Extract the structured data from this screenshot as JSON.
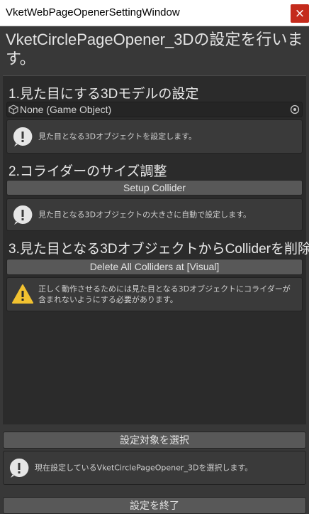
{
  "window": {
    "title": "VketWebPageOpenerSettingWindow",
    "close_glyph": "×"
  },
  "heading": "VketCirclePageOpener_3Dの設定を行います。",
  "section1": {
    "title": "1.見た目にする3Dモデルの設定",
    "object_field_value": "None (Game Object)",
    "help": "見た目となる3Dオブジェクトを設定します。"
  },
  "section2": {
    "title": "2.コライダーのサイズ調整",
    "button": "Setup Collider",
    "help": "見た目となる3Dオブジェクトの大きさに自動で設定します。"
  },
  "section3": {
    "title": "3.見た目となる3DオブジェクトからColliderを削除",
    "button": "Delete All Colliders at [Visual]",
    "warning": "正しく動作させるためには見た目となる3Dオブジェクトにコライダーが含まれないようにする必要があります。"
  },
  "footer": {
    "select_button": "設定対象を選択",
    "help": "現在設定しているVketCirclePageOpener_3Dを選択します。",
    "finish_button": "設定を終了"
  },
  "colors": {
    "info_icon": "#e6e6e6",
    "warning_icon": "#f2c230",
    "close_bg": "#c42b1c"
  }
}
